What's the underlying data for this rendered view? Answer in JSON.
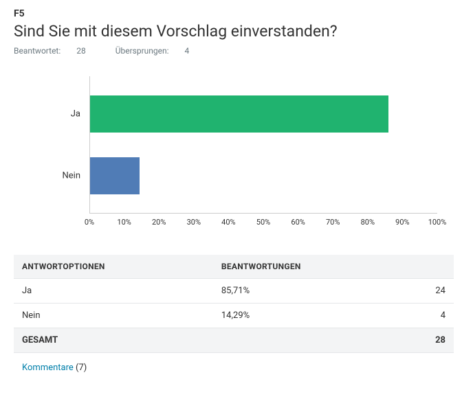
{
  "question_tag": "F5",
  "question_title": "Sind Sie mit diesem Vorschlag einverstanden?",
  "meta": {
    "answered_label": "Beantwortet:",
    "answered_value": "28",
    "skipped_label": "Übersprungen:",
    "skipped_value": "4"
  },
  "chart_data": {
    "type": "bar",
    "orientation": "horizontal",
    "categories": [
      "Ja",
      "Nein"
    ],
    "values": [
      85.71,
      14.29
    ],
    "colors": [
      "#20b36f",
      "#507cb6"
    ],
    "xlabel": "",
    "ylabel": "",
    "xlim": [
      0,
      100
    ],
    "xticks": [
      "0%",
      "10%",
      "20%",
      "30%",
      "40%",
      "50%",
      "60%",
      "70%",
      "80%",
      "90%",
      "100%"
    ]
  },
  "table": {
    "headers": {
      "options": "ANTWORTOPTIONEN",
      "responses": "BEANTWORTUNGEN"
    },
    "rows": [
      {
        "label": "Ja",
        "pct": "85,71%",
        "count": "24"
      },
      {
        "label": "Nein",
        "pct": "14,29%",
        "count": "4"
      }
    ],
    "total": {
      "label": "GESAMT",
      "count": "28"
    }
  },
  "comments": {
    "label": "Kommentare",
    "count": "(7)"
  }
}
